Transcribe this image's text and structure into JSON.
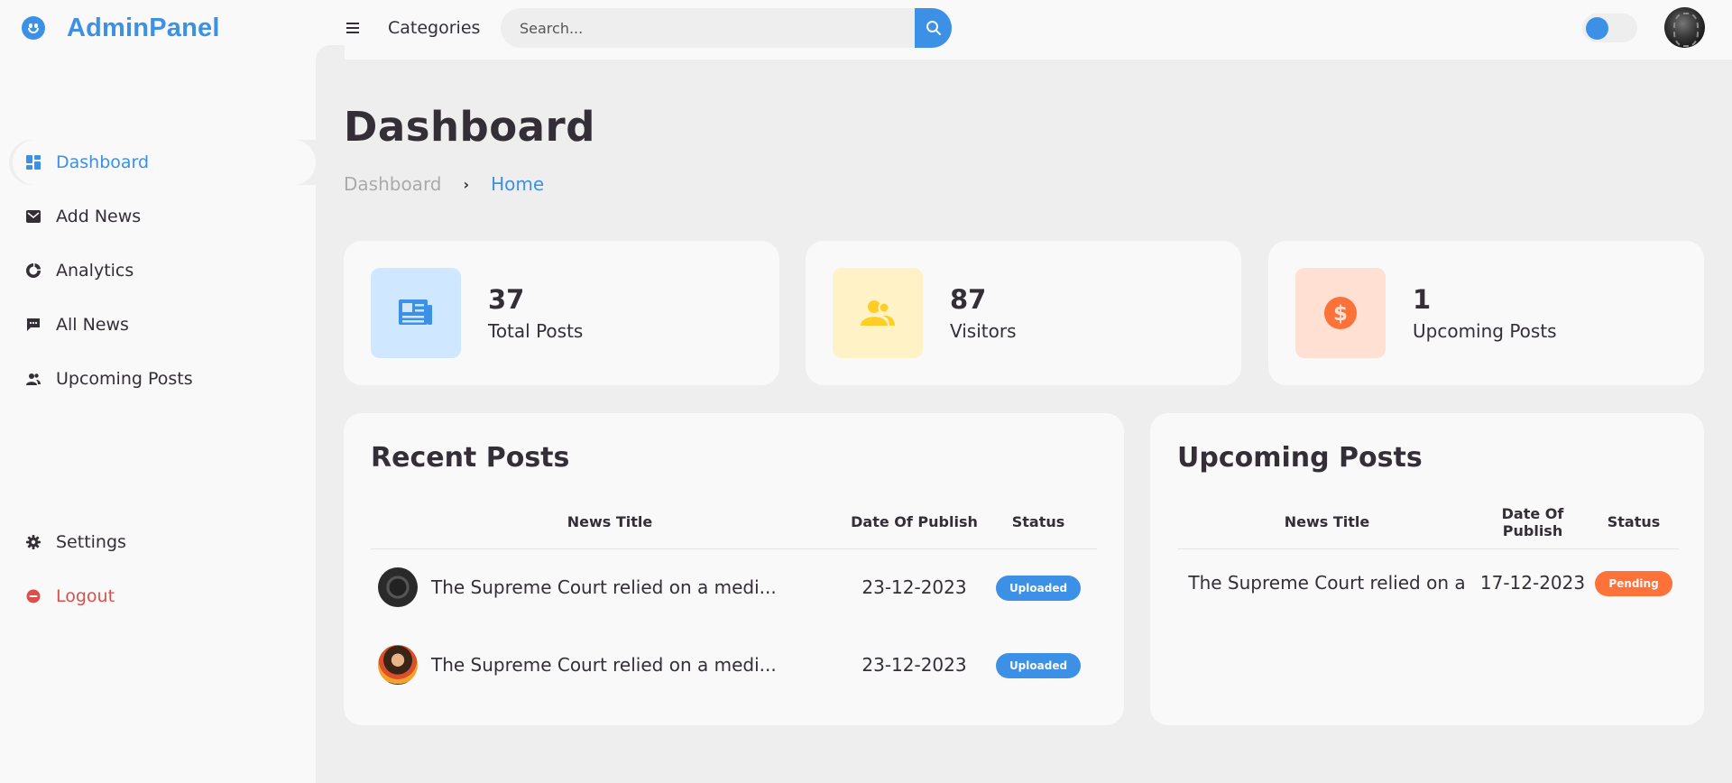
{
  "brand": {
    "name": "AdminPanel",
    "icon": "smile-icon"
  },
  "topbar": {
    "categories_label": "Categories",
    "search_placeholder": "Search...",
    "search_value": ""
  },
  "sidebar": {
    "items": [
      {
        "label": "Dashboard",
        "icon": "dashboard-icon",
        "active": true
      },
      {
        "label": "Add News",
        "icon": "mail-icon"
      },
      {
        "label": "Analytics",
        "icon": "pie-chart-icon"
      },
      {
        "label": "All News",
        "icon": "message-icon"
      },
      {
        "label": "Upcoming Posts",
        "icon": "users-icon"
      }
    ],
    "bottom": [
      {
        "label": "Settings",
        "icon": "gear-icon"
      },
      {
        "label": "Logout",
        "icon": "logout-icon"
      }
    ]
  },
  "page": {
    "title": "Dashboard",
    "breadcrumb": [
      "Dashboard",
      "Home"
    ]
  },
  "stats": [
    {
      "value": "37",
      "label": "Total Posts",
      "icon": "newspaper-icon",
      "color": "#3c91e6",
      "bg": "#cfe8ff"
    },
    {
      "value": "87",
      "label": "Visitors",
      "icon": "group-icon",
      "color": "#ffce26",
      "bg": "#fff2c6"
    },
    {
      "value": "1",
      "label": "Upcoming Posts",
      "icon": "dollar-icon",
      "color": "#fd7238",
      "bg": "#ffe0d3"
    }
  ],
  "recent_posts": {
    "title": "Recent Posts",
    "columns": [
      "News Title",
      "Date Of Publish",
      "Status"
    ],
    "rows": [
      {
        "title": "The Supreme Court relied on a medi...",
        "date": "23-12-2023",
        "status": "Uploaded"
      },
      {
        "title": "The Supreme Court relied on a medi...",
        "date": "23-12-2023",
        "status": "Uploaded"
      }
    ]
  },
  "upcoming_posts": {
    "title": "Upcoming Posts",
    "columns": [
      "News Title",
      "Date Of Publish",
      "Status"
    ],
    "rows": [
      {
        "title": "The Supreme Court relied on a",
        "date": "17-12-2023",
        "status": "Pending"
      }
    ]
  },
  "colors": {
    "accent": "#3c91e6",
    "danger": "#db504a",
    "orange": "#fd7238",
    "yellow": "#ffce26"
  }
}
